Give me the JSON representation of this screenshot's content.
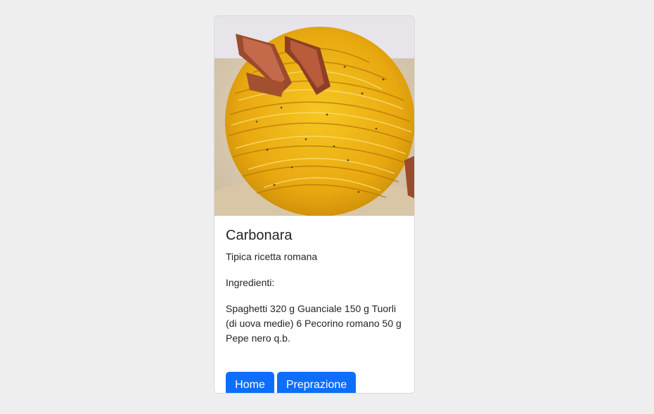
{
  "card": {
    "image_alt": "Carbonara",
    "title": "Carbonara",
    "subtitle": "Tipica ricetta romana",
    "ingredients_label": "Ingredienti:",
    "ingredients_text": "Spaghetti 320 g Guanciale 150 g Tuorli (di uova medie) 6 Pecorino romano 50 g Pepe nero q.b.",
    "buttons": {
      "home": "Home",
      "preparation": "Preprazione"
    }
  },
  "colors": {
    "page_background": "#eeeeee",
    "card_background": "#ffffff",
    "button_primary": "#0d6efd",
    "text": "#212529"
  }
}
